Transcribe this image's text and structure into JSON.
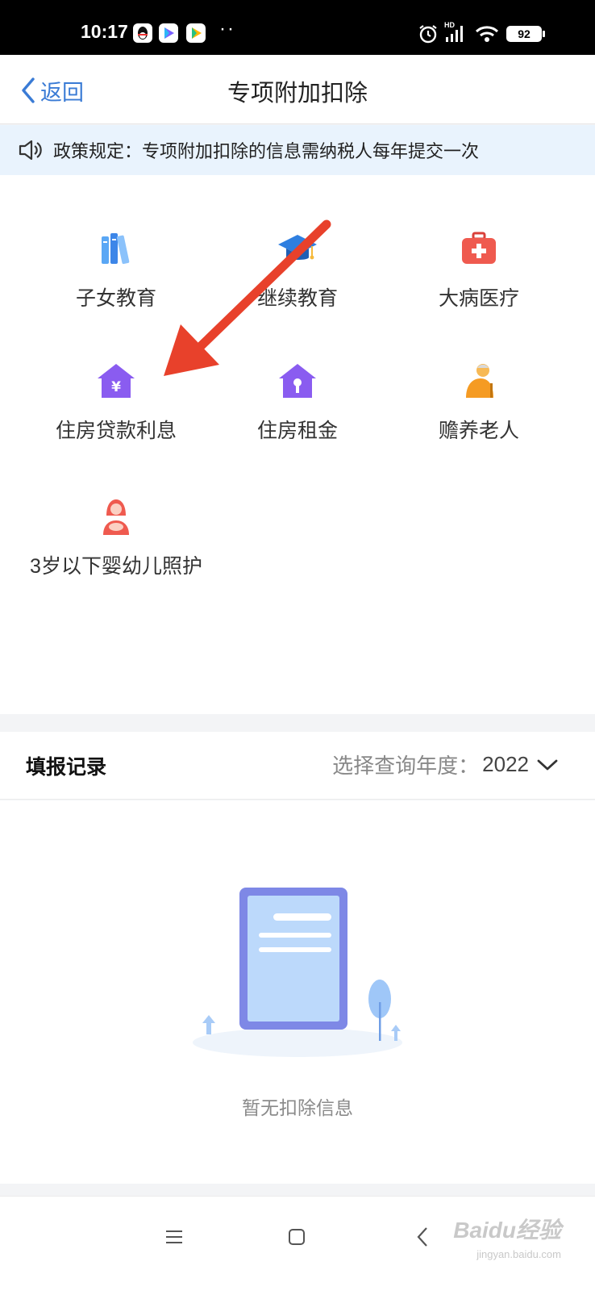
{
  "status_bar": {
    "time": "10:17",
    "battery": "92",
    "network_badge": "HD"
  },
  "header": {
    "back_label": "返回",
    "title": "专项附加扣除"
  },
  "notice": {
    "text": "政策规定：专项附加扣除的信息需纳税人每年提交一次"
  },
  "categories": [
    {
      "label": "子女教育",
      "icon": "books-icon"
    },
    {
      "label": "继续教育",
      "icon": "graduation-cap-icon"
    },
    {
      "label": "大病医疗",
      "icon": "medical-kit-icon"
    },
    {
      "label": "住房贷款利息",
      "icon": "house-yen-icon"
    },
    {
      "label": "住房租金",
      "icon": "house-key-icon"
    },
    {
      "label": "赡养老人",
      "icon": "elderly-icon"
    },
    {
      "label": "3岁以下婴幼儿照护",
      "icon": "mother-baby-icon"
    }
  ],
  "records": {
    "title": "填报记录",
    "year_prompt": "选择查询年度：",
    "year": "2022",
    "empty_text": "暂无扣除信息"
  },
  "watermark": {
    "brand": "Baidu经验",
    "url": "jingyan.baidu.com"
  },
  "colors": {
    "accent": "#3a7bd5",
    "notice_bg": "#e9f3fd",
    "arrow": "#e8412b"
  }
}
